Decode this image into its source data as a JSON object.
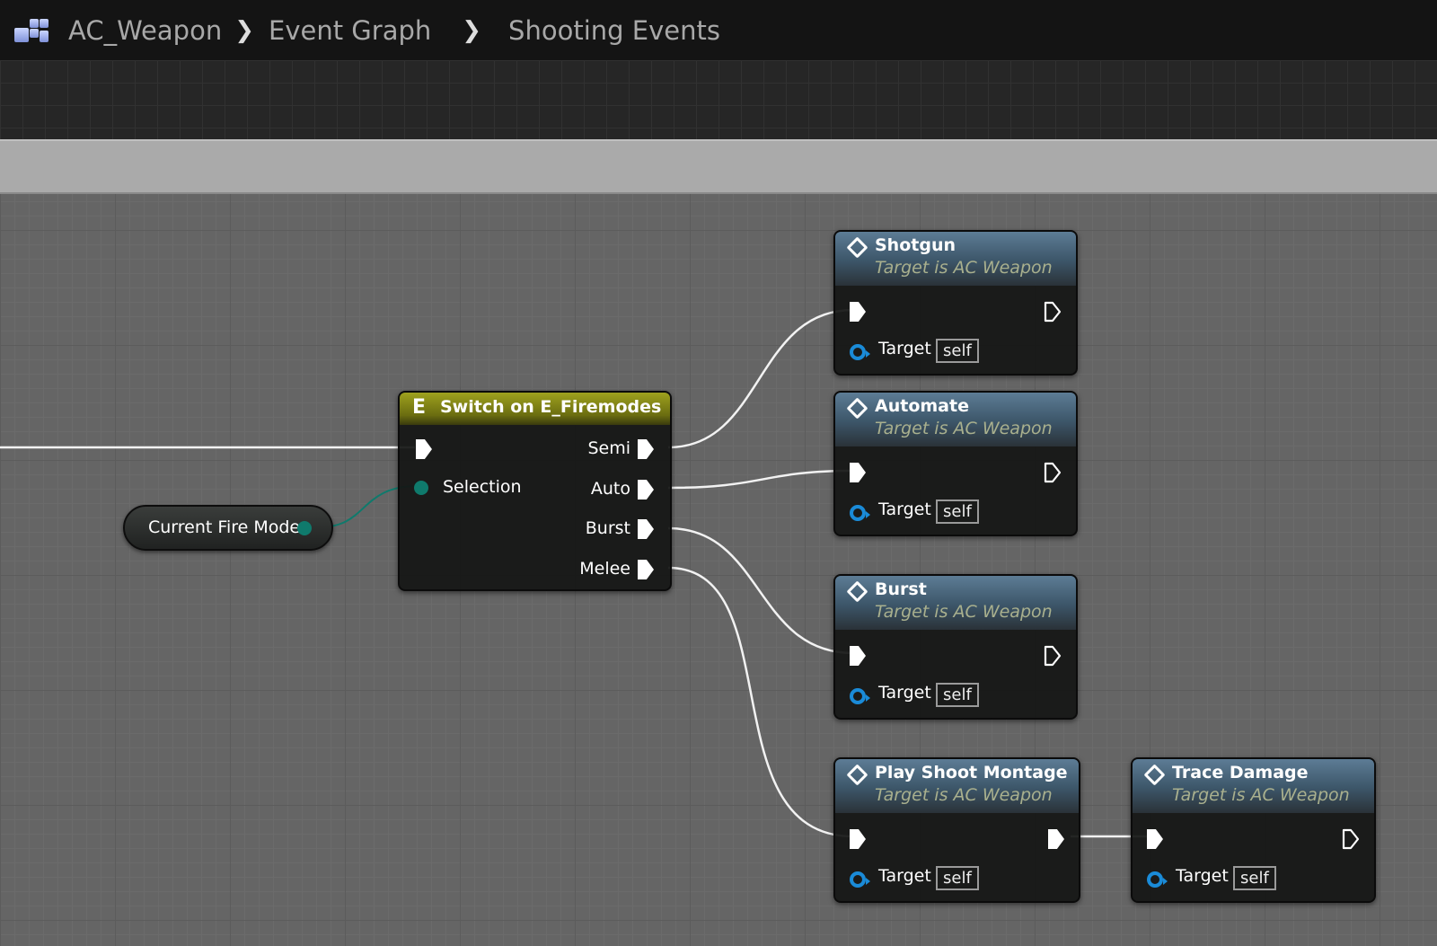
{
  "breadcrumb": {
    "items": [
      "AC_Weapon",
      "Event Graph",
      "Shooting Events"
    ]
  },
  "switch_node": {
    "title": "Switch on E_Firemodes",
    "input": "Selection",
    "outputs": [
      "Semi",
      "Auto",
      "Burst",
      "Melee"
    ]
  },
  "variable_node": {
    "label": "Current Fire Mode"
  },
  "function_nodes": [
    {
      "title": "Shotgun",
      "subtitle": "Target is AC Weapon",
      "pin": "Target",
      "value": "self"
    },
    {
      "title": "Automate",
      "subtitle": "Target is AC Weapon",
      "pin": "Target",
      "value": "self"
    },
    {
      "title": "Burst",
      "subtitle": "Target is AC Weapon",
      "pin": "Target",
      "value": "self"
    },
    {
      "title": "Play Shoot Montage",
      "subtitle": "Target is AC Weapon",
      "pin": "Target",
      "value": "self"
    },
    {
      "title": "Trace Damage",
      "subtitle": "Target is AC Weapon",
      "pin": "Target",
      "value": "self"
    }
  ],
  "colors": {
    "function_header": "#4a6a82",
    "switch_header": "#9ea11e",
    "object_pin": "#1a8bd8",
    "enum_pin": "#0f7a6c"
  }
}
